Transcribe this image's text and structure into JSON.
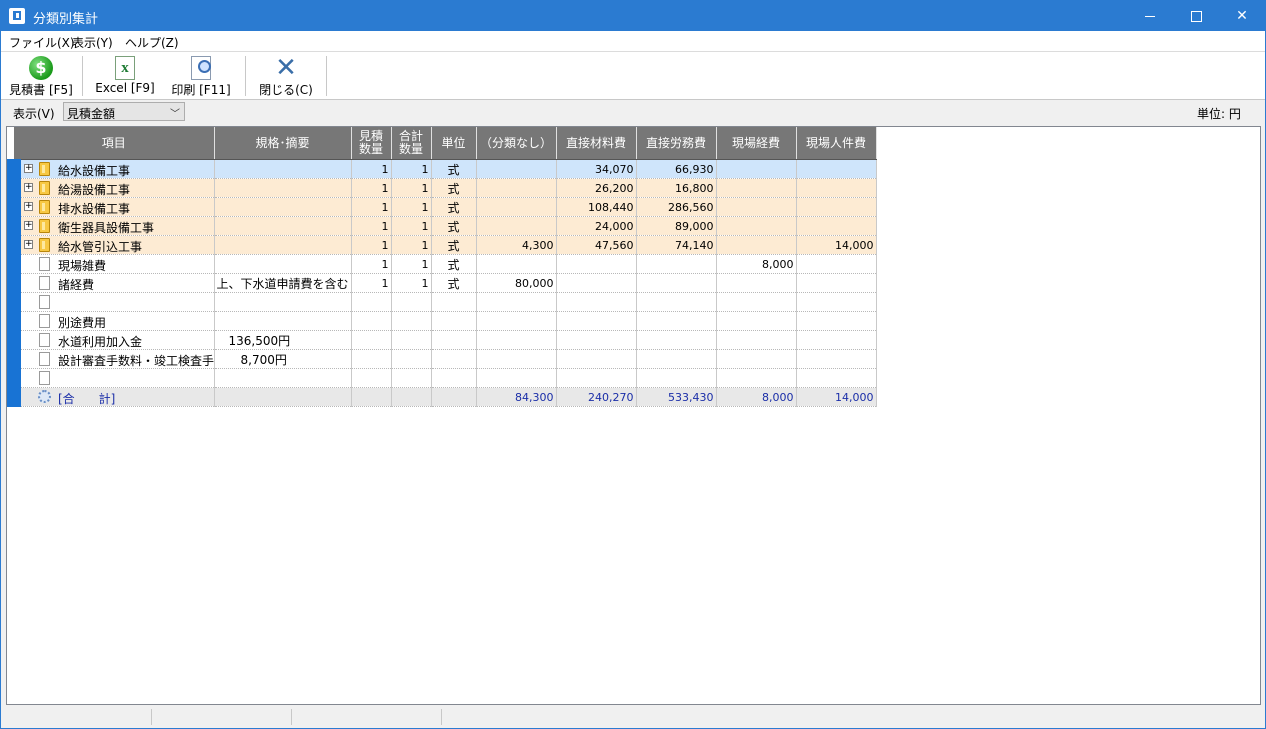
{
  "window": {
    "title": "分類別集計",
    "minimize": "",
    "maximize": "",
    "close": "✕"
  },
  "menu": [
    {
      "label": "ファイル(X)"
    },
    {
      "label": "表示(Y)"
    },
    {
      "label": "ヘルプ(Z)"
    }
  ],
  "toolbar": {
    "estimate_label": "見積書 [F5]",
    "excel_label": "Excel [F9]",
    "print_label": "印刷 [F11]",
    "close_label": "閉じる(C)"
  },
  "options": {
    "display_label": "表示(V)",
    "display_value": "見積金額",
    "unit_label": "単位: 円"
  },
  "grid": {
    "columns": [
      "項目",
      "規格･摘要",
      "見積\n数量",
      "合計\n数量",
      "単位",
      "（分類なし）",
      "直接材料費",
      "直接労務費",
      "現場経費",
      "現場人件費"
    ],
    "rows": [
      {
        "type": "group",
        "selected": true,
        "name": "給水設備工事",
        "spec": "",
        "qty": "1",
        "total": "1",
        "unit": "式",
        "none": "",
        "mat": "34,070",
        "labor": "66,930",
        "site": "",
        "personnel": ""
      },
      {
        "type": "group",
        "name": "給湯設備工事",
        "spec": "",
        "qty": "1",
        "total": "1",
        "unit": "式",
        "none": "",
        "mat": "26,200",
        "labor": "16,800",
        "site": "",
        "personnel": ""
      },
      {
        "type": "group",
        "name": "排水設備工事",
        "spec": "",
        "qty": "1",
        "total": "1",
        "unit": "式",
        "none": "",
        "mat": "108,440",
        "labor": "286,560",
        "site": "",
        "personnel": ""
      },
      {
        "type": "group",
        "name": "衛生器具設備工事",
        "spec": "",
        "qty": "1",
        "total": "1",
        "unit": "式",
        "none": "",
        "mat": "24,000",
        "labor": "89,000",
        "site": "",
        "personnel": ""
      },
      {
        "type": "group",
        "name": "給水管引込工事",
        "spec": "",
        "qty": "1",
        "total": "1",
        "unit": "式",
        "none": "4,300",
        "mat": "47,560",
        "labor": "74,140",
        "site": "",
        "personnel": "14,000"
      },
      {
        "type": "item",
        "name": "現場雑費",
        "spec": "",
        "qty": "1",
        "total": "1",
        "unit": "式",
        "none": "",
        "mat": "",
        "labor": "",
        "site": "8,000",
        "personnel": ""
      },
      {
        "type": "item",
        "name": "諸経費",
        "spec": "上、下水道申請費を含む",
        "qty": "1",
        "total": "1",
        "unit": "式",
        "none": "80,000",
        "mat": "",
        "labor": "",
        "site": "",
        "personnel": ""
      },
      {
        "type": "item",
        "name": "",
        "spec": "",
        "qty": "",
        "total": "",
        "unit": "",
        "none": "",
        "mat": "",
        "labor": "",
        "site": "",
        "personnel": ""
      },
      {
        "type": "item",
        "name": "別途費用",
        "spec": "",
        "qty": "",
        "total": "",
        "unit": "",
        "none": "",
        "mat": "",
        "labor": "",
        "site": "",
        "personnel": ""
      },
      {
        "type": "item",
        "name": "水道利用加入金",
        "spec": "　136,500円",
        "qty": "",
        "total": "",
        "unit": "",
        "none": "",
        "mat": "",
        "labor": "",
        "site": "",
        "personnel": ""
      },
      {
        "type": "item",
        "name": "設計審査手数料・竣工検査手数料",
        "spec": "　　8,700円",
        "qty": "",
        "total": "",
        "unit": "",
        "none": "",
        "mat": "",
        "labor": "",
        "site": "",
        "personnel": ""
      },
      {
        "type": "item",
        "name": "",
        "spec": "",
        "qty": "",
        "total": "",
        "unit": "",
        "none": "",
        "mat": "",
        "labor": "",
        "site": "",
        "personnel": ""
      },
      {
        "type": "total",
        "name": "[合　　計]",
        "spec": "",
        "qty": "",
        "total": "",
        "unit": "",
        "none": "84,300",
        "mat": "240,270",
        "labor": "533,430",
        "site": "8,000",
        "personnel": "14,000"
      }
    ]
  }
}
